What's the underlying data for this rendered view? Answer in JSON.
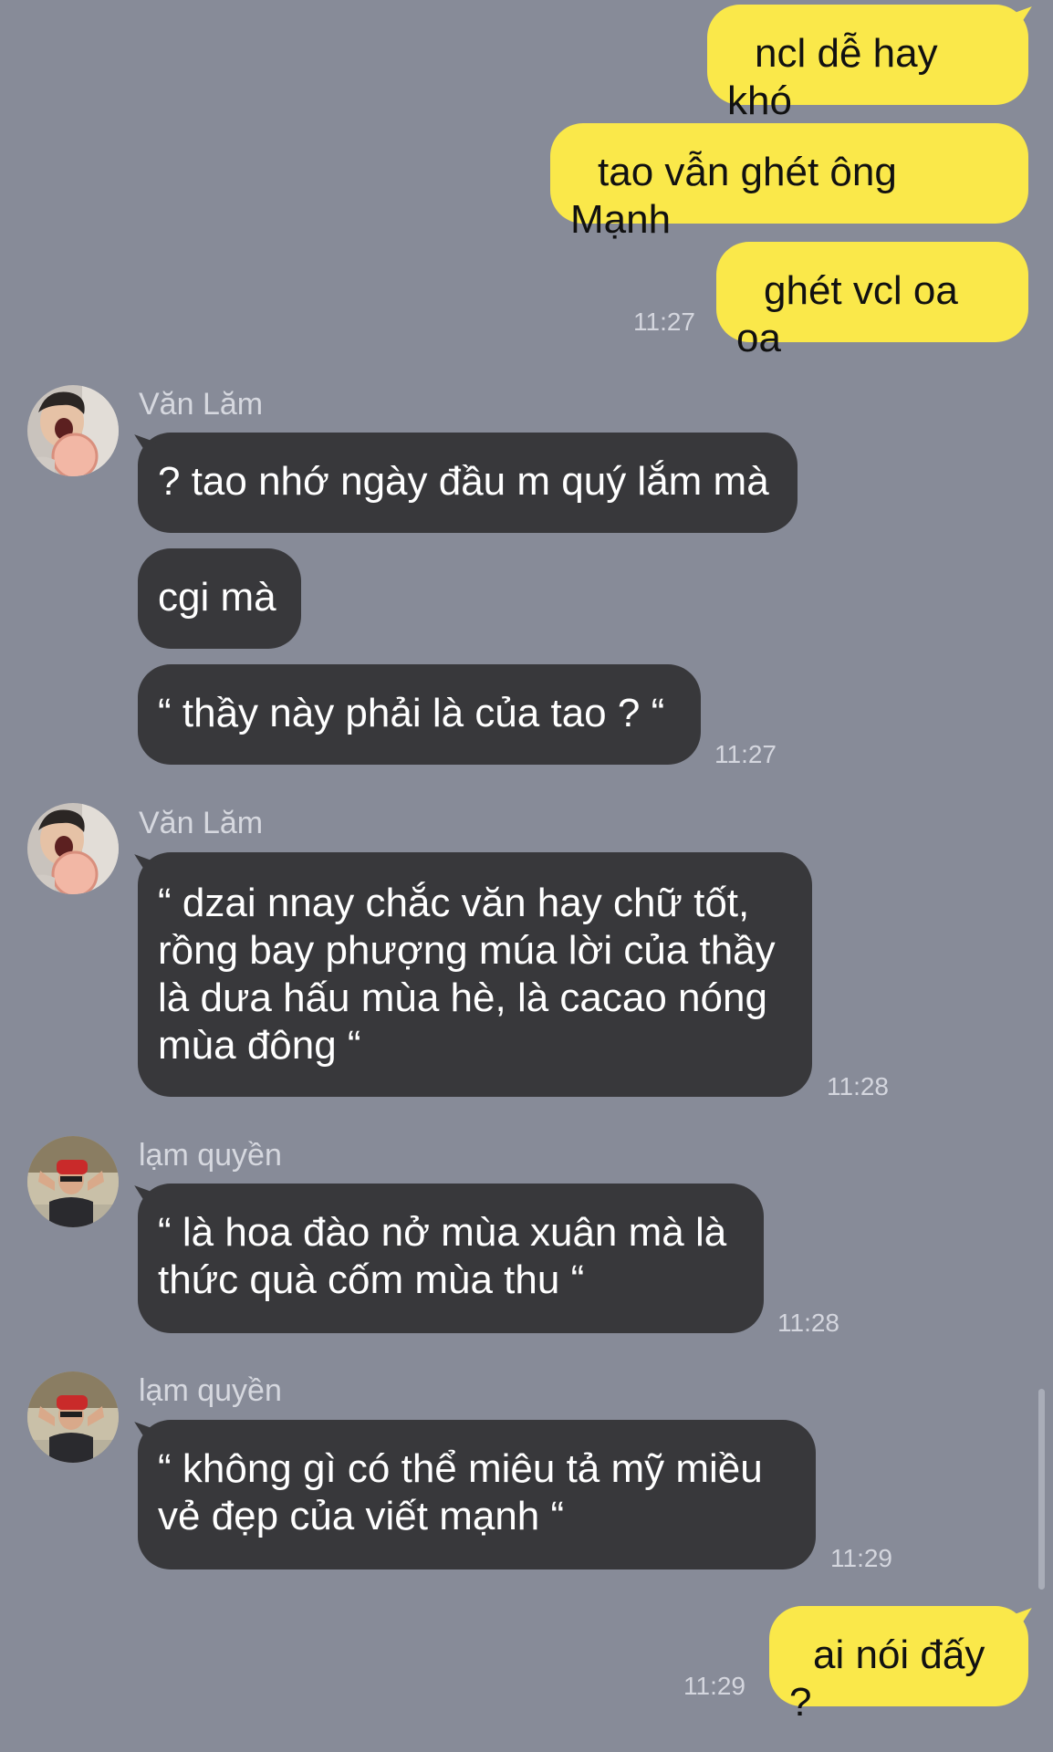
{
  "messages": {
    "m1": "ncl dễ hay khó",
    "m2": "tao vẫn ghét ông Mạnh",
    "m3": "ghét vcl oa oa",
    "t1": "11:27",
    "s1": "Văn Lăm",
    "m4": "? tao nhớ ngày đầu m quý lắm mà",
    "m5": "cgi mà",
    "m6": "“ thầy này phải là của tao ? “",
    "t2": "11:27",
    "s2": "Văn Lăm",
    "m7_l1": "“ dzai nnay chắc văn hay chữ tốt,",
    "m7_l2": "rồng bay phượng múa lời của thầy",
    "m7_l3": "là dưa hấu mùa hè, là cacao nóng",
    "m7_l4": "mùa đông “",
    "t3": "11:28",
    "s3": "lạm quyền",
    "m8_l1": "“ là hoa đào nở mùa xuân mà là",
    "m8_l2": "thức quà cốm mùa thu “",
    "t4": "11:28",
    "s4": "lạm quyền",
    "m9_l1": "“ không gì có thể miêu tả mỹ miều",
    "m9_l2": "vẻ đẹp của viết mạnh “",
    "t5": "11:29",
    "m10": "ai nói đấy ?",
    "t6": "11:29"
  },
  "colors": {
    "background": "#878b98",
    "outgoing_bubble": "#fae84a",
    "incoming_bubble": "#38383b"
  }
}
